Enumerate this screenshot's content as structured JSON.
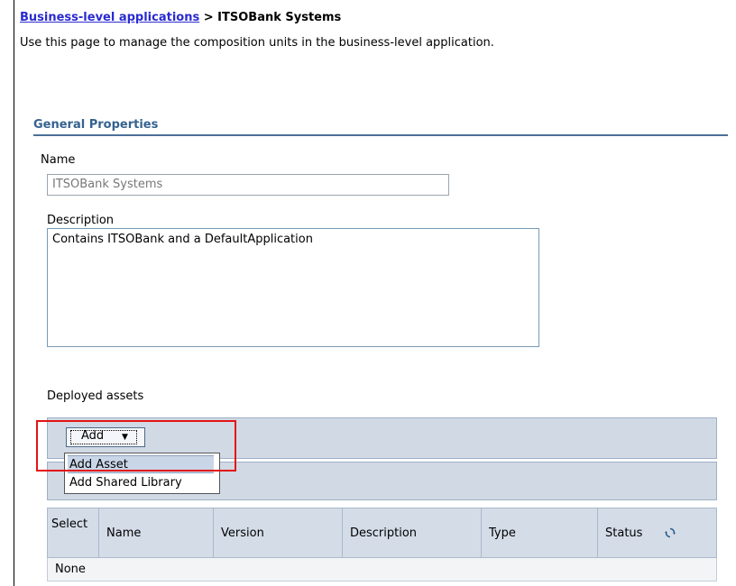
{
  "breadcrumb": {
    "link": "Business-level applications",
    "separator": " > ",
    "current": "ITSOBank Systems"
  },
  "intro_text": "Use this page to manage the composition units in the business-level application.",
  "general_properties": {
    "title": "General Properties",
    "name_label": "Name",
    "name_value": "ITSOBank Systems",
    "description_label": "Description",
    "description_value": "Contains ITSOBank and a DefaultApplication"
  },
  "deployed_assets": {
    "label": "Deployed assets",
    "add_button": "Add",
    "add_menu": [
      "Add Asset",
      "Add Shared Library"
    ],
    "columns": [
      "Select",
      "Name",
      "Version",
      "Description",
      "Type",
      "Status"
    ],
    "empty_row": "None",
    "refresh_icon": "refresh-icon"
  },
  "colors": {
    "link": "#2a2ad0",
    "section_title": "#34628f",
    "toolbar_bg": "#d1d9e5",
    "highlight_border": "#e31414"
  }
}
